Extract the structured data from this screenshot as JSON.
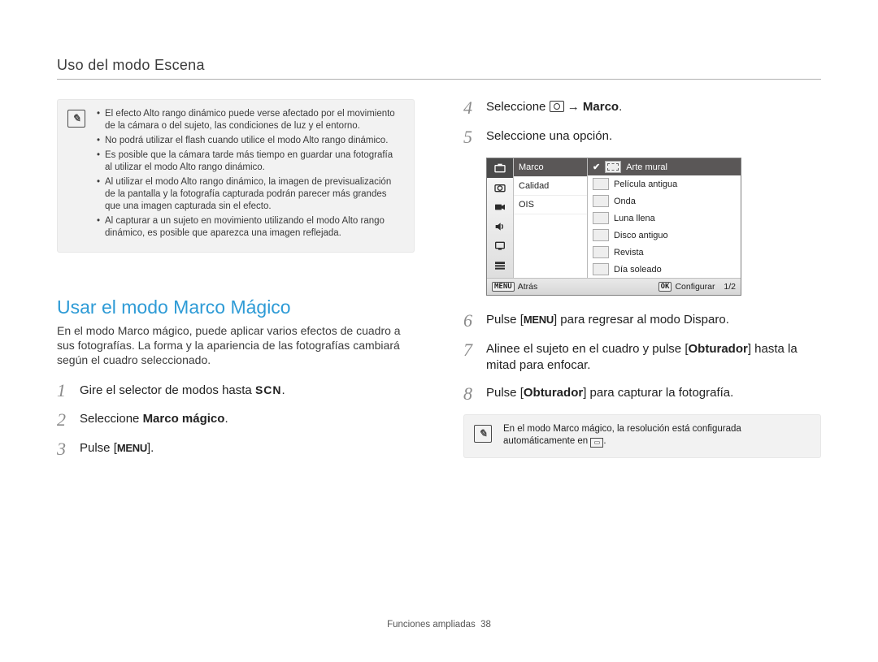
{
  "header": {
    "title": "Uso del modo Escena"
  },
  "note1": {
    "items": [
      "El efecto Alto rango dinámico puede verse afectado por el movimiento de la cámara o del sujeto, las condiciones de luz y el entorno.",
      "No podrá utilizar el flash cuando utilice el modo Alto rango dinámico.",
      "Es posible que la cámara tarde más tiempo en guardar una fotografía al utilizar el modo Alto rango dinámico.",
      "Al utilizar el modo Alto rango dinámico, la imagen de previsualización de la pantalla y la fotografía capturada podrán parecer más grandes que una imagen capturada sin el efecto.",
      "Al capturar a un sujeto en movimiento utilizando el modo Alto rango dinámico, es posible que aparezca una imagen reflejada."
    ]
  },
  "section": {
    "title": "Usar el modo Marco Mágico",
    "intro": "En el modo Marco mágico, puede aplicar varios efectos de cuadro a sus fotografías. La forma y la apariencia de las fotografías cambiará según el cuadro seleccionado."
  },
  "steps_left": {
    "1": {
      "num": "1",
      "text_a": "Gire el selector de modos hasta ",
      "scn": "SCN",
      "text_b": "."
    },
    "2": {
      "num": "2",
      "text_a": "Seleccione ",
      "bold": "Marco mágico",
      "text_b": "."
    },
    "3": {
      "num": "3",
      "text_a": "Pulse [",
      "menu": "MENU",
      "text_b": "]."
    }
  },
  "steps_right": {
    "4": {
      "num": "4",
      "text_a": "Seleccione ",
      "text_b": " → ",
      "bold": "Marco",
      "text_c": "."
    },
    "5": {
      "num": "5",
      "text": "Seleccione una opción."
    },
    "6": {
      "num": "6",
      "text_a": "Pulse [",
      "menu": "MENU",
      "text_b": "] para regresar al modo Disparo."
    },
    "7": {
      "num": "7",
      "text_a": "Alinee el sujeto en el cuadro y pulse [",
      "bold": "Obturador",
      "text_b": "] hasta la mitad para enfocar."
    },
    "8": {
      "num": "8",
      "text_a": "Pulse [",
      "bold": "Obturador",
      "text_b": "] para capturar la fotografía."
    }
  },
  "menu_shot": {
    "mid": {
      "marco": "Marco",
      "calidad": "Calidad",
      "ois": "OIS"
    },
    "right": {
      "arte": "Arte mural",
      "pelicula": "Película antigua",
      "onda": "Onda",
      "luna": "Luna llena",
      "disco": "Disco antiguo",
      "revista": "Revista",
      "dia": "Día soleado"
    },
    "foot": {
      "back_btn": "MENU",
      "back": "Atrás",
      "ok_btn": "OK",
      "cfg": "Configurar",
      "page": "1/2"
    }
  },
  "note2": {
    "text_a": "En el modo Marco mágico, la resolución está configurada automáticamente en ",
    "text_b": "."
  },
  "footer": {
    "label": "Funciones ampliadas",
    "page": "38"
  }
}
